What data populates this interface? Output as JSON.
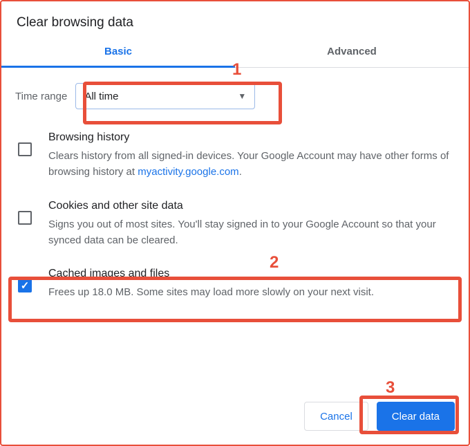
{
  "title": "Clear browsing data",
  "tabs": {
    "basic": "Basic",
    "advanced": "Advanced"
  },
  "time": {
    "label": "Time range",
    "value": "All time"
  },
  "options": {
    "browsing": {
      "title": "Browsing history",
      "desc_a": "Clears history from all signed-in devices. Your Google Account may have other forms of browsing history at ",
      "link": "myactivity.google.com",
      "desc_b": "."
    },
    "cookies": {
      "title": "Cookies and other site data",
      "desc": "Signs you out of most sites. You'll stay signed in to your Google Account so that your synced data can be cleared."
    },
    "cache": {
      "title": "Cached images and files",
      "desc": "Frees up 18.0 MB. Some sites may load more slowly on your next visit."
    }
  },
  "footer": {
    "cancel": "Cancel",
    "clear": "Clear data"
  },
  "annotations": {
    "n1": "1",
    "n2": "2",
    "n3": "3"
  }
}
